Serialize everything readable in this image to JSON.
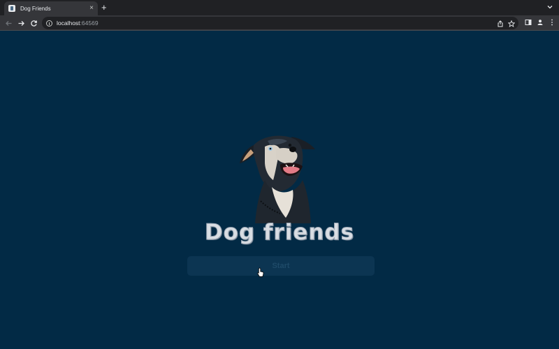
{
  "browser": {
    "tab_title": "Dog Friends",
    "tab_close": "×",
    "new_tab": "+",
    "url_host": "localhost",
    "url_port": ":64569"
  },
  "page": {
    "title": "Dog friends",
    "start_label": "Start"
  }
}
